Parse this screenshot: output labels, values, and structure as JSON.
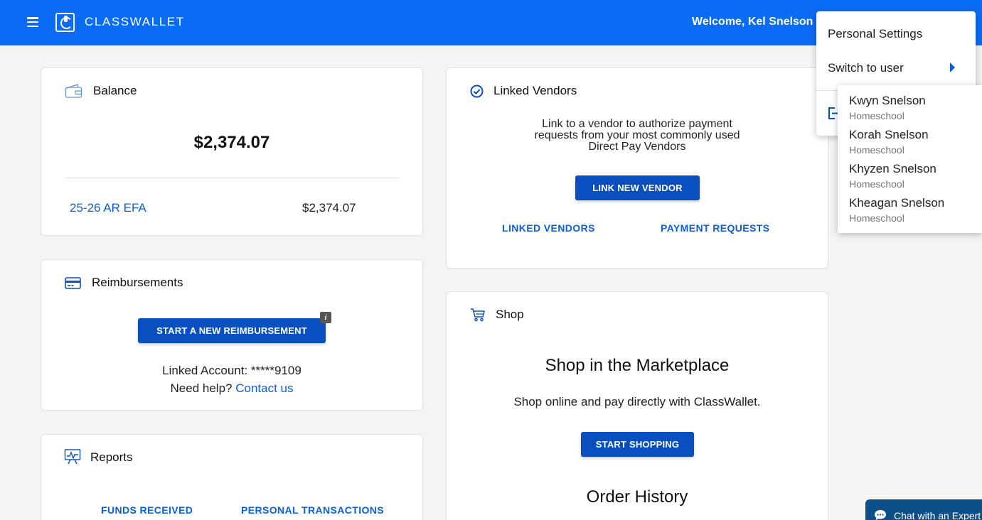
{
  "header": {
    "logo_text": "CLASSWALLET",
    "welcome": "Welcome, Kel Snelson"
  },
  "balance": {
    "title": "Balance",
    "amount": "$2,374.07",
    "fund_name": "25-26 AR EFA",
    "fund_amount": "$2,374.07"
  },
  "reimbursements": {
    "title": "Reimbursements",
    "button": "START A NEW REIMBURSEMENT",
    "info_badge": "i",
    "linked_account": "Linked Account: *****9109",
    "help_text": "Need help?",
    "contact_link": "Contact us"
  },
  "reports": {
    "title": "Reports",
    "funds_received": "FUNDS RECEIVED",
    "personal_transactions": "PERSONAL TRANSACTIONS"
  },
  "linked_vendors": {
    "title": "Linked Vendors",
    "description_line1": "Link to a vendor to authorize payment",
    "description_line2": "requests from your most commonly used",
    "description_line3": "Direct Pay Vendors",
    "button": "LINK NEW VENDOR",
    "linked_vendors_link": "LINKED VENDORS",
    "payment_requests_link": "PAYMENT REQUESTS"
  },
  "shop": {
    "title": "Shop",
    "heading": "Shop in the Marketplace",
    "subtitle": "Shop online and pay directly with ClassWallet.",
    "button": "START SHOPPING",
    "order_history": "Order History"
  },
  "user_menu": {
    "personal_settings": "Personal Settings",
    "switch_to_user": "Switch to user"
  },
  "switch_users": [
    {
      "name": "Kwyn Snelson",
      "role": "Homeschool"
    },
    {
      "name": "Korah Snelson",
      "role": "Homeschool"
    },
    {
      "name": "Khyzen Snelson",
      "role": "Homeschool"
    },
    {
      "name": "Kheagan Snelson",
      "role": "Homeschool"
    }
  ],
  "chat": {
    "label": "Chat with an Expert"
  },
  "colors": {
    "header_bg": "#0a6cf5",
    "button_bg": "#0a4fbf",
    "link": "#0a5fd6",
    "chat_bg": "#0d4f88"
  }
}
